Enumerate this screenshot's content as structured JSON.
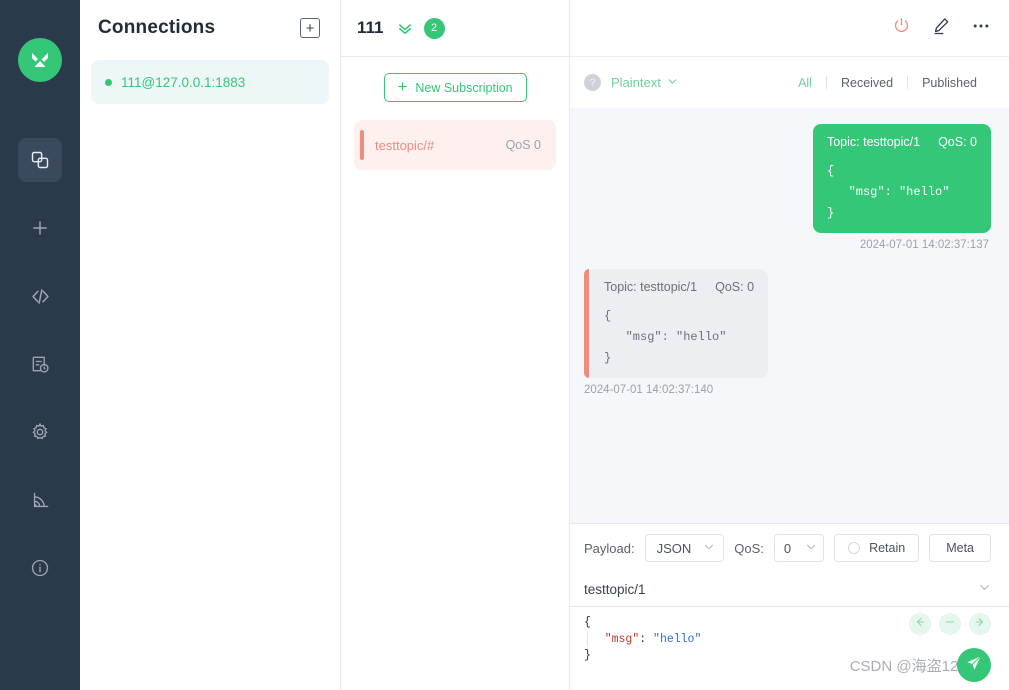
{
  "app": {
    "logo_icon": "mqttx-logo-icon"
  },
  "rail": {
    "items": [
      {
        "name": "connections",
        "icon": "copy-squares-icon"
      },
      {
        "name": "new-connection",
        "icon": "plus-icon"
      },
      {
        "name": "scripts",
        "icon": "code-icon"
      },
      {
        "name": "log",
        "icon": "log-clock-icon"
      },
      {
        "name": "settings",
        "icon": "gear-icon"
      },
      {
        "name": "broadcast",
        "icon": "rss-icon"
      },
      {
        "name": "about",
        "icon": "info-icon"
      }
    ]
  },
  "connections": {
    "title": "Connections",
    "add_icon": "plus-box-icon",
    "items": [
      {
        "name": "111@127.0.0.1:1883",
        "status": "connected"
      }
    ]
  },
  "subscriptions": {
    "title": "111",
    "collapse_icon": "double-chevron-down-icon",
    "badge": "2",
    "new_button": "New Subscription",
    "new_button_icon": "plus-icon",
    "items": [
      {
        "topic": "testtopic/#",
        "qos": "QoS 0"
      }
    ]
  },
  "header_actions": {
    "disconnect_icon": "power-icon",
    "edit_icon": "pencil-icon",
    "more_icon": "ellipsis-icon"
  },
  "messages_toolbar": {
    "help_icon": "question-circle-icon",
    "format": "Plaintext",
    "format_chevron_icon": "chevron-down-icon",
    "filters": [
      {
        "label": "All",
        "active": true
      },
      {
        "label": "Received",
        "active": false
      },
      {
        "label": "Published",
        "active": false
      }
    ]
  },
  "messages": [
    {
      "direction": "published",
      "topic_label": "Topic: testtopic/1",
      "qos_label": "QoS: 0",
      "payload": "{\n   \"msg\": \"hello\"\n}",
      "timestamp": "2024-07-01 14:02:37:137"
    },
    {
      "direction": "received",
      "topic_label": "Topic: testtopic/1",
      "qos_label": "QoS: 0",
      "payload": "{\n   \"msg\": \"hello\"\n}",
      "timestamp": "2024-07-01 14:02:37:140"
    }
  ],
  "publish": {
    "payload_label": "Payload:",
    "payload_value": "JSON",
    "qos_label": "QoS:",
    "qos_value": "0",
    "retain_label": "Retain",
    "retain_checked": false,
    "meta_label": "Meta",
    "topic_value": "testtopic/1",
    "topic_chevron_icon": "chevron-down-icon",
    "editor": {
      "brace_open": "{",
      "key": "\"msg\"",
      "colon": ": ",
      "value": "\"hello\"",
      "brace_close": "}"
    },
    "nav_prev_icon": "arrow-left-icon",
    "nav_minus_icon": "minus-icon",
    "nav_next_icon": "arrow-right-icon",
    "send_icon": "send-plane-icon"
  },
  "watermark": "CSDN @海盗1234",
  "colors": {
    "accent_green": "#34c777",
    "received_red": "#f08c7d",
    "rail_bg": "#2b3a4a",
    "message_bg": "#f6f7fb"
  }
}
